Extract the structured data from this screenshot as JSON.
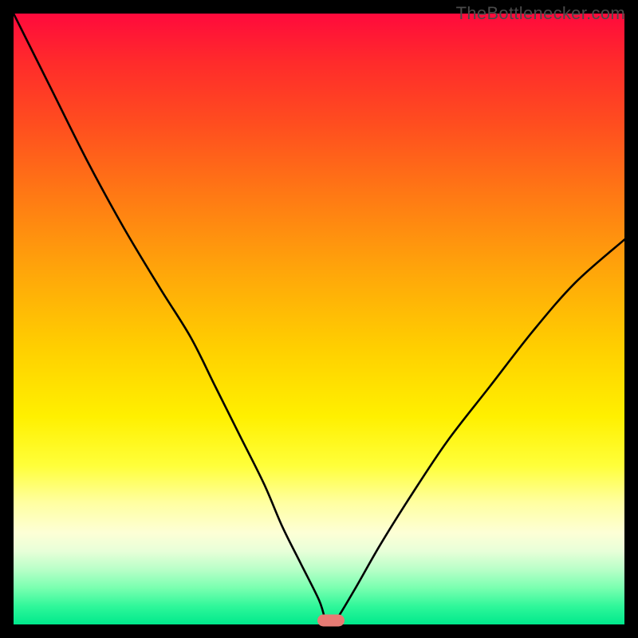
{
  "watermark": {
    "text": "TheBottlenecker.com"
  },
  "chart_data": {
    "type": "line",
    "title": "",
    "xlabel": "",
    "ylabel": "",
    "xlim": [
      0,
      100
    ],
    "ylim": [
      0,
      100
    ],
    "background_gradient": {
      "direction": "vertical",
      "meaning": "low-y = good (green), high-y = bad (red)",
      "stops": [
        {
          "color": "#ff0a3c",
          "pct": 0
        },
        {
          "color": "#ffa50a",
          "pct": 42
        },
        {
          "color": "#ffff3a",
          "pct": 74
        },
        {
          "color": "#00e98c",
          "pct": 100
        }
      ]
    },
    "series": [
      {
        "name": "bottleneck-curve",
        "x": [
          0,
          6,
          12,
          18,
          24,
          29,
          33,
          37,
          41,
          44,
          47,
          50,
          51,
          52,
          53,
          56,
          60,
          65,
          71,
          78,
          85,
          92,
          100
        ],
        "y": [
          100,
          88,
          76,
          65,
          55,
          47,
          39,
          31,
          23,
          16,
          10,
          4,
          1,
          0,
          1,
          6,
          13,
          21,
          30,
          39,
          48,
          56,
          63
        ]
      }
    ],
    "marker": {
      "name": "optimal-point",
      "x": 52,
      "y": 0,
      "color": "#e77b74"
    }
  }
}
